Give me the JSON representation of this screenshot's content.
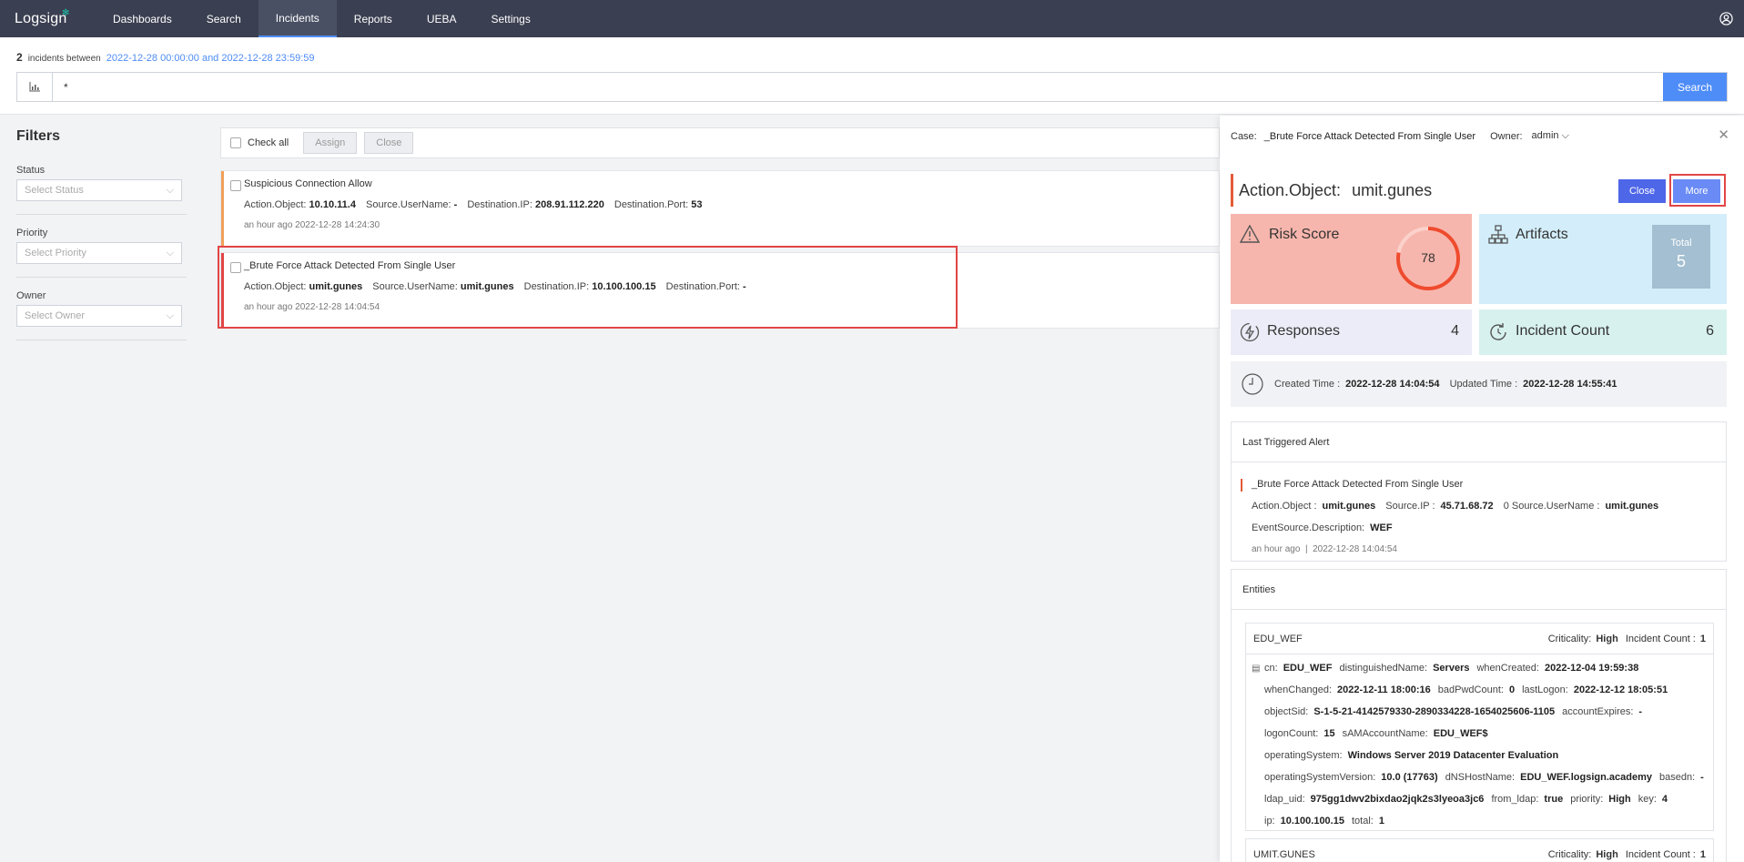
{
  "app": {
    "logo": "Logsign"
  },
  "nav": [
    {
      "label": "Dashboards",
      "active": false
    },
    {
      "label": "Search",
      "active": false
    },
    {
      "label": "Incidents",
      "active": true
    },
    {
      "label": "Reports",
      "active": false
    },
    {
      "label": "UEBA",
      "active": false
    },
    {
      "label": "Settings",
      "active": false
    }
  ],
  "header": {
    "count": "2",
    "between": "incidents between",
    "range": "2022-12-28 00:00:00 and 2022-12-28 23:59:59",
    "query": "*",
    "search_label": "Search"
  },
  "filters": {
    "title": "Filters",
    "status": {
      "label": "Status",
      "placeholder": "Select Status"
    },
    "priority": {
      "label": "Priority",
      "placeholder": "Select Priority"
    },
    "owner": {
      "label": "Owner",
      "placeholder": "Select Owner"
    }
  },
  "toolbar": {
    "check_all": "Check all",
    "assign": "Assign",
    "close": "Close"
  },
  "incidents": [
    {
      "title": "Suspicious Connection Allow",
      "color": "#f0a05a",
      "fields": [
        {
          "k": "Action.Object:",
          "v": "10.10.11.4"
        },
        {
          "k": "Source.UserName:",
          "v": "-"
        },
        {
          "k": "Destination.IP:",
          "v": "208.91.112.220"
        },
        {
          "k": "Destination.Port:",
          "v": "53"
        }
      ],
      "time": "an hour ago 2022-12-28 14:24:30"
    },
    {
      "title": "_Brute Force Attack Detected From Single User",
      "color": "#e24545",
      "fields": [
        {
          "k": "Action.Object:",
          "v": "umit.gunes"
        },
        {
          "k": "Source.UserName:",
          "v": "umit.gunes"
        },
        {
          "k": "Destination.IP:",
          "v": "10.100.100.15"
        },
        {
          "k": "Destination.Port:",
          "v": "-"
        }
      ],
      "time": "an hour ago 2022-12-28 14:04:54"
    }
  ],
  "panel": {
    "case_label": "Case:",
    "case_name": "_Brute Force Attack Detected From Single User",
    "owner_label": "Owner:",
    "owner_name": "admin",
    "object_label": "Action.Object:",
    "object_value": "umit.gunes",
    "close_label": "Close",
    "more_label": "More",
    "risk": {
      "label": "Risk Score",
      "value": "78",
      "fraction": 0.78
    },
    "artifacts": {
      "label": "Artifacts",
      "total_label": "Total",
      "total": "5"
    },
    "responses": {
      "label": "Responses",
      "value": "4"
    },
    "incident_count": {
      "label": "Incident Count",
      "value": "6"
    },
    "created_label": "Created Time :",
    "created": "2022-12-28 14:04:54",
    "updated_label": "Updated Time :",
    "updated": "2022-12-28 14:55:41",
    "last_alert": {
      "heading": "Last Triggered Alert",
      "title": "_Brute Force Attack Detected From Single User",
      "line1": [
        {
          "k": "Action.Object :",
          "v": "umit.gunes"
        },
        {
          "k": "Source.IP :",
          "v": "45.71.68.72"
        },
        {
          "k": "0 Source.UserName :",
          "v": "umit.gunes"
        }
      ],
      "line2": [
        {
          "k": "EventSource.Description:",
          "v": "WEF"
        }
      ],
      "ago": "an hour ago",
      "sep": "|",
      "time": "2022-12-28 14:04:54"
    },
    "entities": {
      "heading": "Entities",
      "items": [
        {
          "name": "EDU_WEF",
          "criticality_label": "Criticality:",
          "criticality": "High",
          "count_label": "Incident Count :",
          "count": "1",
          "lines": [
            [
              {
                "k": "cn:",
                "v": "EDU_WEF"
              },
              {
                "k": "distinguishedName:",
                "v": "Servers"
              },
              {
                "k": "whenCreated:",
                "v": "2022-12-04 19:59:38"
              }
            ],
            [
              {
                "k": "whenChanged:",
                "v": "2022-12-11 18:00:16"
              },
              {
                "k": "badPwdCount:",
                "v": "0"
              },
              {
                "k": "lastLogon:",
                "v": "2022-12-12 18:05:51"
              }
            ],
            [
              {
                "k": "objectSid:",
                "v": "S-1-5-21-4142579330-2890334228-1654025606-1105"
              },
              {
                "k": "accountExpires:",
                "v": "-"
              }
            ],
            [
              {
                "k": "logonCount:",
                "v": "15"
              },
              {
                "k": "sAMAccountName:",
                "v": "EDU_WEF$"
              }
            ],
            [
              {
                "k": "operatingSystem:",
                "v": "Windows Server 2019 Datacenter Evaluation"
              }
            ],
            [
              {
                "k": "operatingSystemVersion:",
                "v": "10.0 (17763)"
              },
              {
                "k": "dNSHostName:",
                "v": "EDU_WEF.logsign.academy"
              },
              {
                "k": "basedn:",
                "v": "-"
              }
            ],
            [
              {
                "k": "ldap_uid:",
                "v": "975gg1dwv2bixdao2jqk2s3lyeoa3jc6"
              },
              {
                "k": "from_ldap:",
                "v": "true"
              },
              {
                "k": "priority:",
                "v": "High"
              },
              {
                "k": "key:",
                "v": "4"
              }
            ],
            [
              {
                "k": "ip:",
                "v": "10.100.100.15"
              },
              {
                "k": "total:",
                "v": "1"
              }
            ]
          ]
        },
        {
          "name": "UMIT.GUNES",
          "criticality_label": "Criticality:",
          "criticality": "High",
          "count_label": "Incident Count :",
          "count": "1",
          "lines": []
        }
      ]
    }
  },
  "colors": {
    "accent": "#4e8cf7",
    "nav_bg": "#3a3f51",
    "highlight": "#e24545"
  }
}
